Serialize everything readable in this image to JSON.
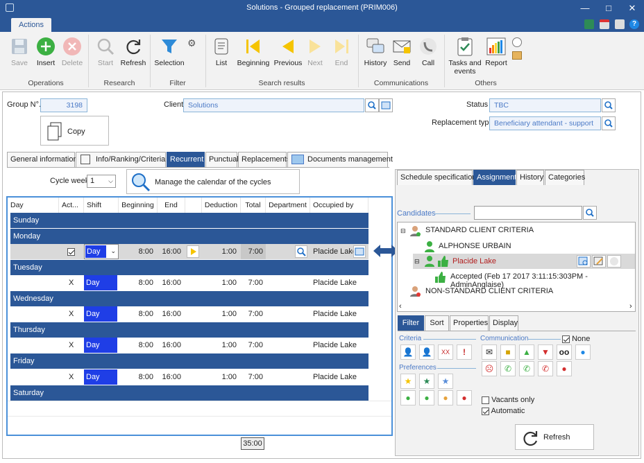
{
  "window": {
    "title": "Solutions - Grouped replacement (PRIM006)",
    "tab": "Actions"
  },
  "ribbon": {
    "buttons": {
      "save": "Save",
      "insert": "Insert",
      "delete": "Delete",
      "start": "Start",
      "refresh": "Refresh",
      "selection": "Selection",
      "list": "List",
      "beginning": "Beginning",
      "previous": "Previous",
      "next": "Next",
      "end": "End",
      "history": "History",
      "send": "Send",
      "call": "Call",
      "tasks": "Tasks and events",
      "report": "Report"
    },
    "groups": {
      "operations": "Operations",
      "research": "Research",
      "filter": "Filter",
      "search_results": "Search results",
      "communications": "Communications",
      "others": "Others"
    }
  },
  "form": {
    "group_label": "Group N°.",
    "group_value": "3198",
    "client_label": "Client",
    "client_value": "Solutions",
    "status_label": "Status",
    "status_value": "TBC",
    "replacement_type_label": "Replacement type",
    "replacement_type_value": "Beneficiary attendant - support",
    "copy_label": "Copy"
  },
  "tabs": [
    "General informations",
    "Info/Ranking/Criteria",
    "Recurrent",
    "Punctual",
    "Replacements",
    "Documents management"
  ],
  "cycle": {
    "label": "Cycle week",
    "value": "1",
    "manage_label": "Manage the calendar of the cycles"
  },
  "grid": {
    "headers": [
      "Day",
      "Act...",
      "Shift",
      "Beginning",
      "End",
      "",
      "Deduction",
      "Total",
      "Department",
      "Occupied by"
    ],
    "days": [
      "Sunday",
      "Monday",
      "Tuesday",
      "Wednesday",
      "Thursday",
      "Friday",
      "Saturday"
    ],
    "rows": [
      {
        "active": "checkbox",
        "shift": "Day",
        "beginning": "8:00",
        "end": "16:00",
        "deduction": "1:00",
        "total": "7:00",
        "occupied": "Placide Lake"
      },
      {
        "active": "X",
        "shift": "Day",
        "beginning": "8:00",
        "end": "16:00",
        "deduction": "1:00",
        "total": "7:00",
        "occupied": "Placide Lake"
      },
      {
        "active": "X",
        "shift": "Day",
        "beginning": "8:00",
        "end": "16:00",
        "deduction": "1:00",
        "total": "7:00",
        "occupied": "Placide Lake"
      },
      {
        "active": "X",
        "shift": "Day",
        "beginning": "8:00",
        "end": "16:00",
        "deduction": "1:00",
        "total": "7:00",
        "occupied": "Placide Lake"
      },
      {
        "active": "X",
        "shift": "Day",
        "beginning": "8:00",
        "end": "16:00",
        "deduction": "1:00",
        "total": "7:00",
        "occupied": "Placide Lake"
      }
    ],
    "total": "35:00"
  },
  "right": {
    "tabs": [
      "Schedule specifications",
      "Assignment",
      "History",
      "Categories"
    ],
    "candidates_label": "Candidates",
    "tree": {
      "standard": "STANDARD CLIENT CRITERIA",
      "alphonse": "ALPHONSE URBAIN",
      "placide": "Placide Lake",
      "accepted": "Accepted (Feb 17 2017  3:11:15:303PM - AdminAnglaise)",
      "nonstandard": "NON-STANDARD CLIENT CRITERIA"
    },
    "filter_tabs": [
      "Filter",
      "Sort",
      "Properties",
      "Display"
    ],
    "criteria_label": "Criteria",
    "communication_label": "Communication",
    "none_label": "None",
    "preferences_label": "Preferences",
    "vacants_label": "Vacants only",
    "automatic_label": "Automatic",
    "refresh_label": "Refresh"
  },
  "colors": {
    "accent": "#2b5797",
    "selected_shift": "#1f3ee6"
  }
}
